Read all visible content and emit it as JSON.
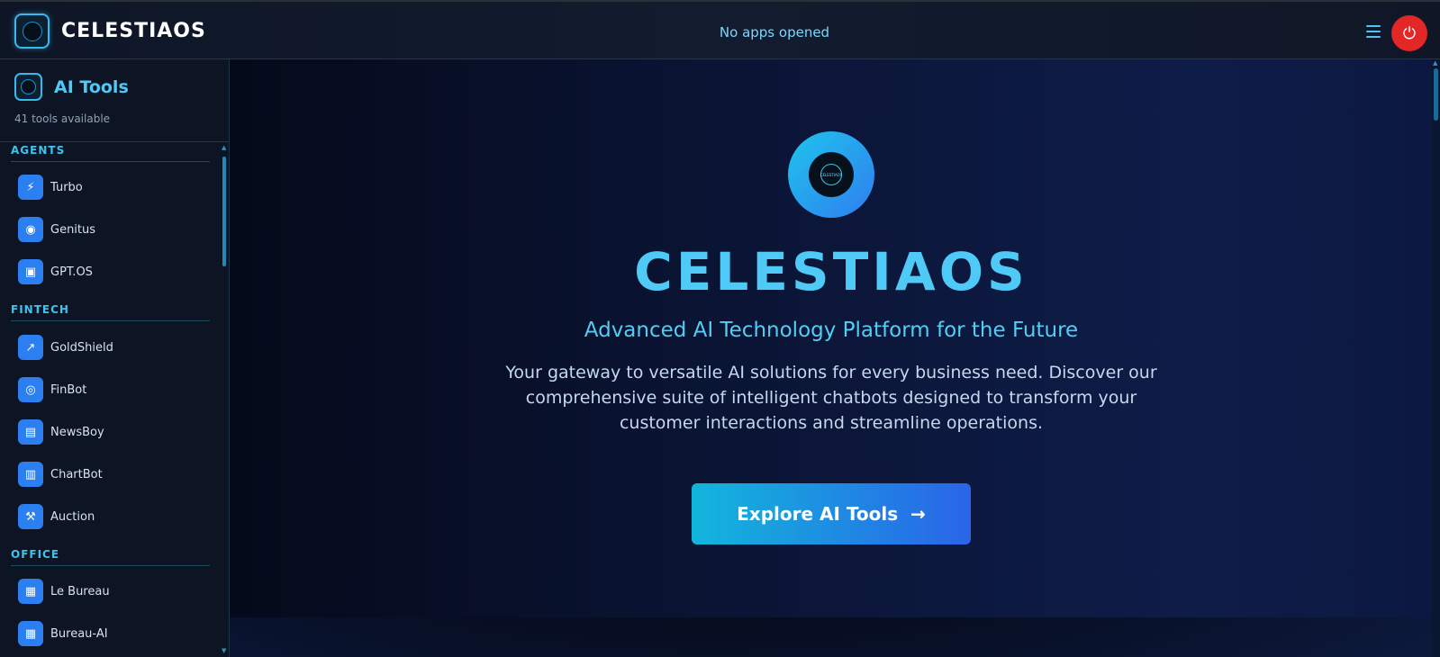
{
  "topbar": {
    "brand": "CELESTIAOS",
    "status": "No apps opened"
  },
  "sidebar": {
    "title": "AI Tools",
    "count": "41 tools available",
    "sections": [
      {
        "label": "AGENTS",
        "items": [
          {
            "label": "Turbo",
            "icon": "bolt-icon"
          },
          {
            "label": "Genitus",
            "icon": "brain-icon"
          },
          {
            "label": "GPT.OS",
            "icon": "robot-icon"
          }
        ]
      },
      {
        "label": "FINTECH",
        "items": [
          {
            "label": "GoldShield",
            "icon": "trend-icon"
          },
          {
            "label": "FinBot",
            "icon": "coins-icon"
          },
          {
            "label": "NewsBoy",
            "icon": "newspaper-icon"
          },
          {
            "label": "ChartBot",
            "icon": "chart-icon"
          },
          {
            "label": "Auction",
            "icon": "gavel-icon"
          }
        ]
      },
      {
        "label": "OFFICE",
        "items": [
          {
            "label": "Le Bureau",
            "icon": "building-icon"
          },
          {
            "label": "Bureau-AI",
            "icon": "building-icon"
          }
        ]
      }
    ]
  },
  "hero": {
    "logo_text": "CELESTIAOS",
    "title": "CELESTIAOS",
    "subtitle": "Advanced AI Technology Platform for the Future",
    "description_lines": [
      "Your gateway to versatile AI solutions for every business need. Discover our",
      "comprehensive suite of intelligent chatbots designed to transform your",
      "customer interactions and streamline operations."
    ],
    "cta_label": "Explore AI Tools"
  },
  "colors": {
    "accent": "#4fc9f5",
    "icon_bg": "#2c7ff0",
    "power": "#e32626"
  }
}
